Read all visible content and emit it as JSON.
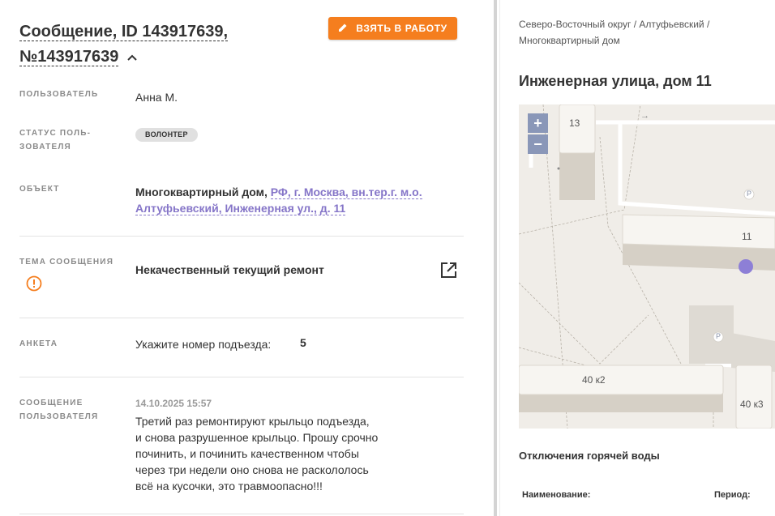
{
  "header": {
    "title_line1": "Сообщение, ID 143917639,",
    "title_line2": "№143917639",
    "take_button": "ВЗЯТЬ В РАБОТУ"
  },
  "fields": {
    "user_label": "ПОЛЬЗОВАТЕЛЬ",
    "user_value": "Анна М.",
    "status_label_1": "СТАТУС ПОЛЬ-",
    "status_label_2": "ЗОВАТЕЛЯ",
    "status_badge": "ВОЛОНТЕР",
    "object_label": "ОБЪЕКТ",
    "object_type": "Многоквартирный дом,",
    "object_addr_1": "РФ, г. Москва, вн.тер.г. м.о.",
    "object_addr_2": "Алтуфьевский, Инженерная ул., д. 11",
    "topic_label": "ТЕМА СООБЩЕНИЯ",
    "topic_value": "Некачественный текущий ремонт",
    "survey_label": "АНКЕТА",
    "survey_question": "Укажите номер подъезда:",
    "survey_answer": "5",
    "message_label_1": "СООБЩЕНИЕ",
    "message_label_2": "ПОЛЬЗОВАТЕЛЯ",
    "message_date": "14.10.2025 15:57",
    "message_lines": [
      "Третий раз ремонтируют крыльцо подъезда,",
      "и снова разрушенное крыльцо. Прошу срочно",
      "починить, и починить качественном чтобы",
      "через три недели оно снова не раскололось",
      "всё на кусочки, это травмоопасно!!!"
    ]
  },
  "right": {
    "breadcrumb_1": "Северо-Восточный округ / Алтуфьевский /",
    "breadcrumb_2": "Многоквартирный дом",
    "address_title": "Инженерная улица, дом 11",
    "map": {
      "zoom_in": "+",
      "zoom_out": "−",
      "labels": {
        "b13": "13",
        "b11": "11",
        "b40k2": "40 к2",
        "b40k3": "40 к3",
        "parking1": "P",
        "parking2": "P",
        "arrow": "→"
      },
      "marker_color": "#8d7fd6"
    },
    "hot_water_title": "Отключения горячей воды",
    "col_name": "Наименование:",
    "col_period": "Период:"
  },
  "colors": {
    "accent": "#f57e1e",
    "link": "#8575c8",
    "warning": "#f57e1e"
  },
  "icons": {
    "take_button": "pencil-icon",
    "title_toggle": "chevron-up-icon",
    "topic": "warning-circle-icon",
    "external": "external-link-icon"
  }
}
